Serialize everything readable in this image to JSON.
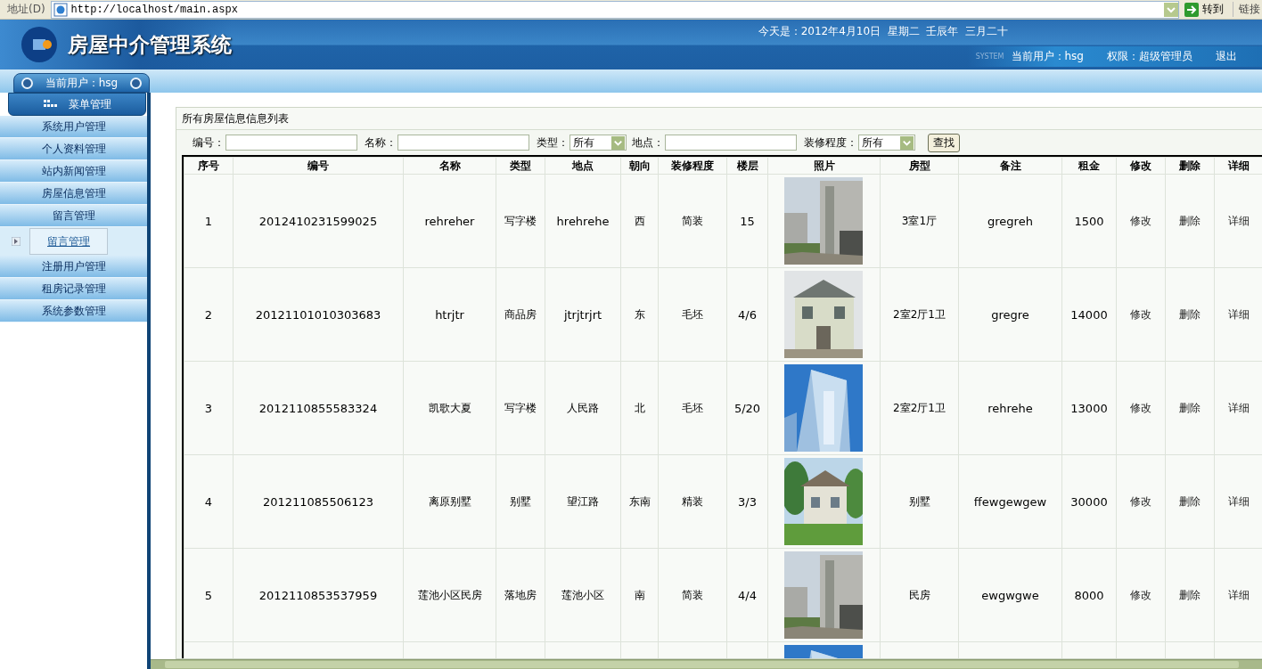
{
  "address_bar": {
    "label": "地址(D)",
    "url": "http://localhost/main.aspx",
    "go_button": "转到",
    "links": "链接"
  },
  "header": {
    "title": "房屋中介管理系统",
    "date": "今天是：2012年4月10日  星期二  壬辰年  三月二十",
    "system_mark": "SYSTEM",
    "current_user": "当前用户：hsg",
    "permission": "权限：超级管理员",
    "logout": "退出"
  },
  "sidebar": {
    "user": "当前用户：hsg",
    "menu_title": "菜单管理",
    "items": [
      {
        "label": "系统用户管理",
        "selected": false
      },
      {
        "label": "个人资料管理",
        "selected": false
      },
      {
        "label": "站内新闻管理",
        "selected": false
      },
      {
        "label": "房屋信息管理",
        "selected": false
      },
      {
        "label": "留言管理",
        "selected": false
      },
      {
        "label": "留言管理",
        "selected": true
      },
      {
        "label": "注册用户管理",
        "selected": false
      },
      {
        "label": "租房记录管理",
        "selected": false
      },
      {
        "label": "系统参数管理",
        "selected": false
      }
    ]
  },
  "panel": {
    "title": "所有房屋信息信息列表",
    "filters": [
      {
        "kind": "text",
        "label": "编号："
      },
      {
        "kind": "text",
        "label": "名称："
      },
      {
        "kind": "select",
        "label": "类型：",
        "value": "所有"
      },
      {
        "kind": "text",
        "label": "地点："
      },
      {
        "kind": "select",
        "label": "装修程度：",
        "value": "所有"
      }
    ],
    "search_button": "查找"
  },
  "table": {
    "columns": [
      "序号",
      "编号",
      "名称",
      "类型",
      "地点",
      "朝向",
      "装修程度",
      "楼层",
      "照片",
      "房型",
      "备注",
      "租金",
      "修改",
      "删除",
      "详细"
    ],
    "rows": [
      {
        "no": "1",
        "code": "2012410231599025",
        "name": "rehreher",
        "type": "写字楼",
        "location": "hrehrehe",
        "facing": "西",
        "decoration": "简装",
        "floor": "15",
        "photo": {
          "kind": "picture"
        },
        "layout": "3室1厅",
        "note": "gregreh",
        "rent": "1500",
        "edit": "修改",
        "delete": "删除",
        "detail": "详细"
      },
      {
        "no": "2",
        "code": "20121101010303683",
        "name": "htrjtr",
        "type": "商品房",
        "location": "jtrjtrjrt",
        "facing": "东",
        "decoration": "毛坯",
        "floor": "4/6",
        "photo": {
          "kind": "picture"
        },
        "layout": "2室2厅1卫",
        "note": "gregre",
        "rent": "14000",
        "edit": "修改",
        "delete": "删除",
        "detail": "详细"
      },
      {
        "no": "3",
        "code": "2012110855583324",
        "name": "凯歌大夏",
        "type": "写字楼",
        "location": "人民路",
        "facing": "北",
        "decoration": "毛坯",
        "floor": "5/20",
        "photo": {
          "kind": "picture"
        },
        "layout": "2室2厅1卫",
        "note": "rehrehe",
        "rent": "13000",
        "edit": "修改",
        "delete": "删除",
        "detail": "详细"
      },
      {
        "no": "4",
        "code": "201211085506123",
        "name": "离原别墅",
        "type": "别墅",
        "location": "望江路",
        "facing": "东南",
        "decoration": "精装",
        "floor": "3/3",
        "photo": {
          "kind": "picture"
        },
        "layout": "别墅",
        "note": "ffewgewgew",
        "rent": "30000",
        "edit": "修改",
        "delete": "删除",
        "detail": "详细"
      },
      {
        "no": "5",
        "code": "2012110853537959",
        "name": "莲池小区民房",
        "type": "落地房",
        "location": "莲池小区",
        "facing": "南",
        "decoration": "简装",
        "floor": "4/4",
        "photo": {
          "kind": "picture"
        },
        "layout": "民房",
        "note": "ewgwgwe",
        "rent": "8000",
        "edit": "修改",
        "delete": "删除",
        "detail": "详细"
      },
      {
        "photo": {
          "kind": "picture"
        }
      }
    ]
  }
}
